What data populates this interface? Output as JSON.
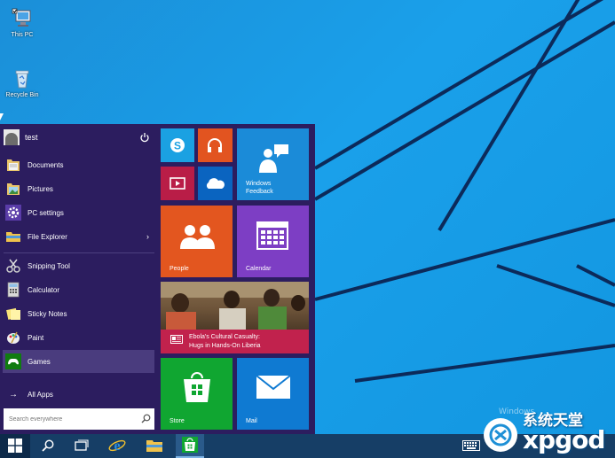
{
  "desktop": {
    "icons": [
      {
        "label": "This PC",
        "glyph": "computer-icon"
      },
      {
        "label": "Recycle Bin",
        "glyph": "recycle-bin-icon"
      }
    ]
  },
  "start_menu": {
    "user": {
      "name": "test"
    },
    "items": [
      {
        "label": "Documents",
        "icon": "documents-folder-icon"
      },
      {
        "label": "Pictures",
        "icon": "pictures-folder-icon"
      },
      {
        "label": "PC settings",
        "icon": "gear-icon"
      },
      {
        "label": "File Explorer",
        "icon": "file-explorer-icon",
        "chevron": "›"
      },
      {
        "label": "Snipping Tool",
        "icon": "snipping-tool-icon"
      },
      {
        "label": "Calculator",
        "icon": "calculator-icon"
      },
      {
        "label": "Sticky Notes",
        "icon": "sticky-notes-icon"
      },
      {
        "label": "Paint",
        "icon": "paint-icon"
      },
      {
        "label": "Games",
        "icon": "games-icon"
      }
    ],
    "all_apps": {
      "label": "All Apps",
      "arrow": "→"
    },
    "search": {
      "placeholder": "Search everywhere"
    },
    "tiles": {
      "skype": {
        "color": "#1ba1e2"
      },
      "music": {
        "color": "#e25420"
      },
      "video": {
        "color": "#b91d47"
      },
      "onedrive": {
        "color": "#0a64c0"
      },
      "windows_feedback": {
        "label": "Windows Feedback",
        "line1": "Windows",
        "line2": "Feedback",
        "color": "#1b8bd8"
      },
      "people": {
        "label": "People",
        "color": "#e3561f"
      },
      "calendar": {
        "label": "Calendar",
        "color": "#7d3ec4"
      },
      "news": {
        "line1": "Ebola's Cultural Casualty:",
        "line2": "Hugs in Hands-On Liberia",
        "color": "#c1224d"
      },
      "store": {
        "label": "Store",
        "color": "#10a631"
      },
      "mail": {
        "label": "Mail",
        "color": "#0f7ad2"
      }
    }
  },
  "taskbar": {
    "buttons": [
      "start-button",
      "search-button",
      "task-view-button",
      "internet-explorer-button",
      "file-explorer-button",
      "store-button"
    ],
    "tray": [
      "touch-keyboard-icon"
    ]
  },
  "watermark": {
    "os_text": "Windows",
    "brand_cn": "系统天堂",
    "brand_latin": "xpgod"
  }
}
